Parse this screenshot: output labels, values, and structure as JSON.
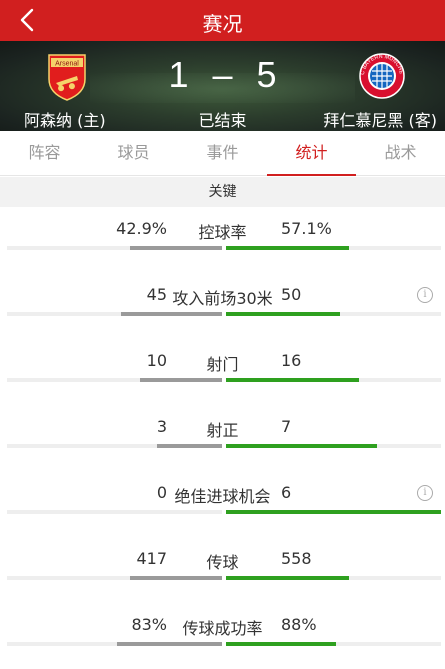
{
  "header": {
    "title": "赛况"
  },
  "match": {
    "home": {
      "name": "阿森纳 (主)",
      "crest_text": "Arsenal",
      "color": "#e11d1d"
    },
    "away": {
      "name": "拜仁慕尼黑 (客)",
      "crest_text": "FC BAYERN MÜNCHEN",
      "color": "#d80f2f"
    },
    "home_score": "1",
    "separator": "–",
    "away_score": "5",
    "status": "已结束"
  },
  "tabs": [
    {
      "label": "阵容"
    },
    {
      "label": "球员"
    },
    {
      "label": "事件"
    },
    {
      "label": "统计",
      "active": true
    },
    {
      "label": "战术"
    }
  ],
  "section_title": "关键",
  "stats": [
    {
      "name": "控球率",
      "left": "42.9%",
      "right": "57.1%",
      "left_fill": 0.43,
      "right_fill": 0.57,
      "info": false
    },
    {
      "name": "攻入前场30米",
      "left": "45",
      "right": "50",
      "left_fill": 0.47,
      "right_fill": 0.53,
      "info": true
    },
    {
      "name": "射门",
      "left": "10",
      "right": "16",
      "left_fill": 0.38,
      "right_fill": 0.62,
      "info": false
    },
    {
      "name": "射正",
      "left": "3",
      "right": "7",
      "left_fill": 0.3,
      "right_fill": 0.7,
      "info": false
    },
    {
      "name": "绝佳进球机会",
      "left": "0",
      "right": "6",
      "left_fill": 0.0,
      "right_fill": 1.0,
      "info": true
    },
    {
      "name": "传球",
      "left": "417",
      "right": "558",
      "left_fill": 0.43,
      "right_fill": 0.57,
      "info": false
    },
    {
      "name": "传球成功率",
      "left": "83%",
      "right": "88%",
      "left_fill": 0.49,
      "right_fill": 0.51,
      "info": false
    }
  ],
  "colors": {
    "accent": "#d11f1f",
    "away_bar": "#2ea01f",
    "home_bar": "#9a9a9a"
  },
  "icons": {
    "back": "chevron-left-icon",
    "info": "info-icon"
  }
}
